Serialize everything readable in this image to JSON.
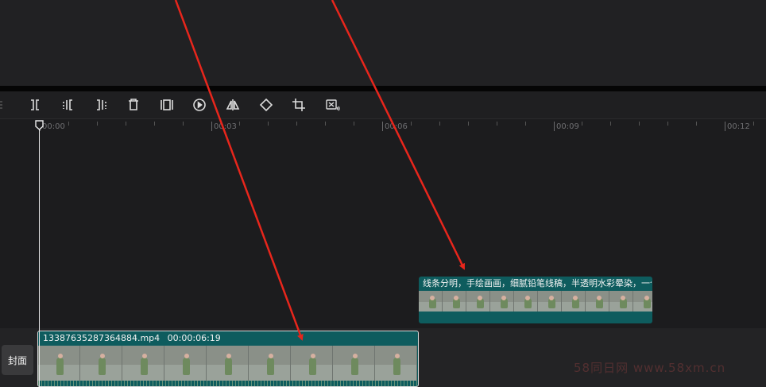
{
  "toolbar": {
    "icons": [
      "split-icon",
      "split-left-icon",
      "split-right-icon",
      "delete-icon",
      "freeze-frame-icon",
      "reverse-play-icon",
      "mirror-icon",
      "rotate-icon",
      "crop-icon",
      "ai-audio-icon"
    ]
  },
  "ruler": {
    "labels": [
      "00:00",
      "00:03",
      "00:06",
      "00:09",
      "00:12"
    ]
  },
  "cover_button": {
    "label": "封面"
  },
  "text_clip": {
    "label": "线条分明，手绘画画，细腻铅笔线稿，半透明水彩晕染，一个才"
  },
  "main_clip": {
    "filename": "13387635287364884.mp4",
    "duration": "00:00:06:19"
  },
  "watermark": {
    "text": "58同日网  www.58xm.cn"
  },
  "colors": {
    "clip_teal": "#0e5c5e",
    "annotation_arrow": "#e8261c",
    "playhead": "#e8e8e8"
  }
}
